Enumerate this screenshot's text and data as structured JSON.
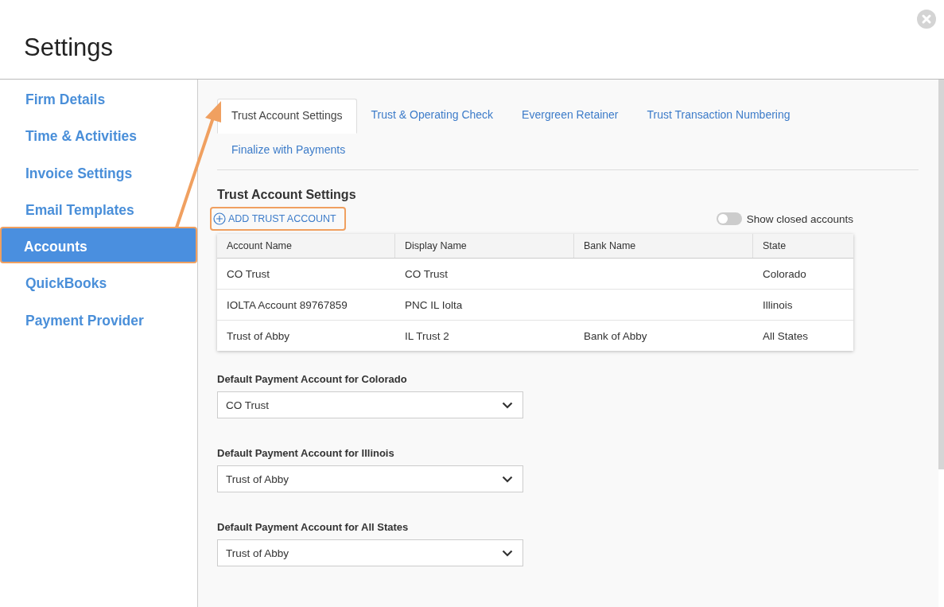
{
  "window": {
    "title": "Settings"
  },
  "sidebar": {
    "items": [
      {
        "label": "Firm Details",
        "selected": false,
        "highlighted": false
      },
      {
        "label": "Time & Activities",
        "selected": false,
        "highlighted": false
      },
      {
        "label": "Invoice Settings",
        "selected": false,
        "highlighted": false
      },
      {
        "label": "Email Templates",
        "selected": false,
        "highlighted": false
      },
      {
        "label": "Accounts",
        "selected": true,
        "highlighted": true
      },
      {
        "label": "QuickBooks",
        "selected": false,
        "highlighted": false
      },
      {
        "label": "Payment Provider",
        "selected": false,
        "highlighted": false
      }
    ]
  },
  "tabs": [
    {
      "label": "Trust Account Settings",
      "selected": true
    },
    {
      "label": "Trust & Operating Check",
      "selected": false
    },
    {
      "label": "Evergreen Retainer",
      "selected": false
    },
    {
      "label": "Trust Transaction Numbering",
      "selected": false
    },
    {
      "label": "Finalize with Payments",
      "selected": false
    }
  ],
  "section": {
    "title": "Trust Account Settings",
    "add_button": {
      "label": "ADD TRUST ACCOUNT",
      "highlighted": true
    },
    "toggle": {
      "label": "Show closed accounts",
      "on": false
    }
  },
  "table": {
    "columns": [
      "Account Name",
      "Display Name",
      "Bank Name",
      "State"
    ],
    "rows": [
      [
        "CO Trust",
        "CO Trust",
        "",
        "Colorado"
      ],
      [
        "IOLTA Account 89767859",
        "PNC IL Iolta",
        "",
        "Illinois"
      ],
      [
        "Trust of Abby",
        "IL Trust 2",
        "Bank of Abby",
        "All States"
      ]
    ]
  },
  "defaults": [
    {
      "label": "Default Payment Account for Colorado",
      "value": "CO Trust"
    },
    {
      "label": "Default Payment Account for Illinois",
      "value": "Trust of Abby"
    },
    {
      "label": "Default Payment Account for All States",
      "value": "Trust of Abby"
    }
  ]
}
